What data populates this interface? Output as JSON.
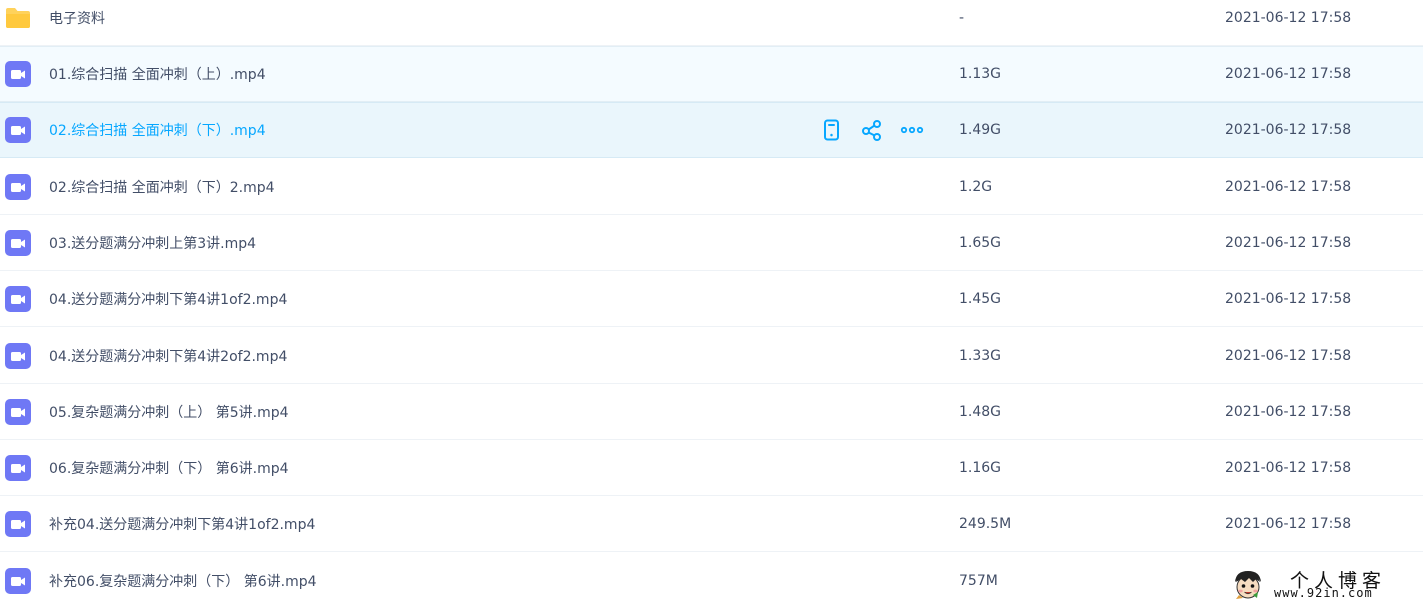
{
  "colors": {
    "link": "#06a7ff",
    "text": "#424e67",
    "video_icon": "#6f78f5",
    "folder_icon": "#ffd25b",
    "selected_bg": "#f4fbff",
    "hover_bg": "#eaf6fc"
  },
  "files": [
    {
      "type": "folder",
      "icon": "folder-icon",
      "name": "电子资料",
      "size": "-",
      "time": "2021-06-12 17:58"
    },
    {
      "type": "video",
      "icon": "video-file-icon",
      "name": "01.综合扫描 全面冲刺（上）.mp4",
      "size": "1.13G",
      "time": "2021-06-12 17:58"
    },
    {
      "type": "video",
      "icon": "video-file-icon",
      "name": "02.综合扫描 全面冲刺（下）.mp4",
      "size": "1.49G",
      "time": "2021-06-12 17:58"
    },
    {
      "type": "video",
      "icon": "video-file-icon",
      "name": "02.综合扫描 全面冲刺（下）2.mp4",
      "size": "1.2G",
      "time": "2021-06-12 17:58"
    },
    {
      "type": "video",
      "icon": "video-file-icon",
      "name": "03.送分题满分冲刺上第3讲.mp4",
      "size": "1.65G",
      "time": "2021-06-12 17:58"
    },
    {
      "type": "video",
      "icon": "video-file-icon",
      "name": "04.送分题满分冲刺下第4讲1of2.mp4",
      "size": "1.45G",
      "time": "2021-06-12 17:58"
    },
    {
      "type": "video",
      "icon": "video-file-icon",
      "name": "04.送分题满分冲刺下第4讲2of2.mp4",
      "size": "1.33G",
      "time": "2021-06-12 17:58"
    },
    {
      "type": "video",
      "icon": "video-file-icon",
      "name": "05.复杂题满分冲刺（上） 第5讲.mp4",
      "size": "1.48G",
      "time": "2021-06-12 17:58"
    },
    {
      "type": "video",
      "icon": "video-file-icon",
      "name": "06.复杂题满分冲刺（下） 第6讲.mp4",
      "size": "1.16G",
      "time": "2021-06-12 17:58"
    },
    {
      "type": "video",
      "icon": "video-file-icon",
      "name": "补充04.送分题满分冲刺下第4讲1of2.mp4",
      "size": "249.5M",
      "time": "2021-06-12 17:58"
    },
    {
      "type": "video",
      "icon": "video-file-icon",
      "name": "补充06.复杂题满分冲刺（下） 第6讲.mp4",
      "size": "757M",
      "time": ""
    }
  ],
  "hover_actions": [
    "phone-icon",
    "share-icon",
    "more-icon"
  ],
  "watermark": {
    "title": "个人博客",
    "url": "www.92in.com",
    "icon": "cartoon-face-icon"
  }
}
